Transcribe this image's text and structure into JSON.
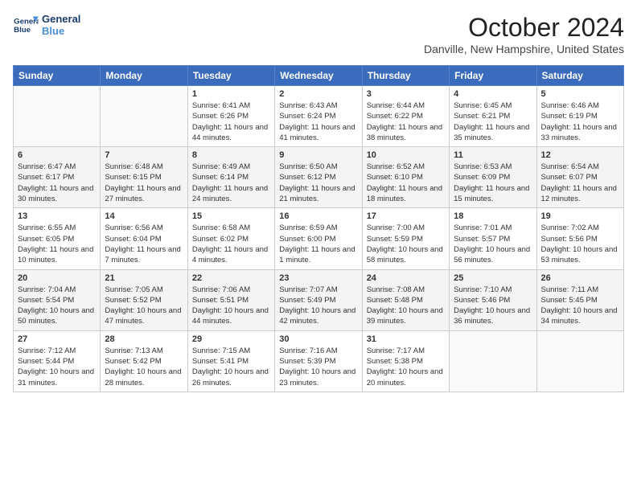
{
  "header": {
    "logo_line1": "General",
    "logo_line2": "Blue",
    "month": "October 2024",
    "location": "Danville, New Hampshire, United States"
  },
  "weekdays": [
    "Sunday",
    "Monday",
    "Tuesday",
    "Wednesday",
    "Thursday",
    "Friday",
    "Saturday"
  ],
  "weeks": [
    [
      {
        "day": "",
        "info": ""
      },
      {
        "day": "",
        "info": ""
      },
      {
        "day": "1",
        "info": "Sunrise: 6:41 AM\nSunset: 6:26 PM\nDaylight: 11 hours and 44 minutes."
      },
      {
        "day": "2",
        "info": "Sunrise: 6:43 AM\nSunset: 6:24 PM\nDaylight: 11 hours and 41 minutes."
      },
      {
        "day": "3",
        "info": "Sunrise: 6:44 AM\nSunset: 6:22 PM\nDaylight: 11 hours and 38 minutes."
      },
      {
        "day": "4",
        "info": "Sunrise: 6:45 AM\nSunset: 6:21 PM\nDaylight: 11 hours and 35 minutes."
      },
      {
        "day": "5",
        "info": "Sunrise: 6:46 AM\nSunset: 6:19 PM\nDaylight: 11 hours and 33 minutes."
      }
    ],
    [
      {
        "day": "6",
        "info": "Sunrise: 6:47 AM\nSunset: 6:17 PM\nDaylight: 11 hours and 30 minutes."
      },
      {
        "day": "7",
        "info": "Sunrise: 6:48 AM\nSunset: 6:15 PM\nDaylight: 11 hours and 27 minutes."
      },
      {
        "day": "8",
        "info": "Sunrise: 6:49 AM\nSunset: 6:14 PM\nDaylight: 11 hours and 24 minutes."
      },
      {
        "day": "9",
        "info": "Sunrise: 6:50 AM\nSunset: 6:12 PM\nDaylight: 11 hours and 21 minutes."
      },
      {
        "day": "10",
        "info": "Sunrise: 6:52 AM\nSunset: 6:10 PM\nDaylight: 11 hours and 18 minutes."
      },
      {
        "day": "11",
        "info": "Sunrise: 6:53 AM\nSunset: 6:09 PM\nDaylight: 11 hours and 15 minutes."
      },
      {
        "day": "12",
        "info": "Sunrise: 6:54 AM\nSunset: 6:07 PM\nDaylight: 11 hours and 12 minutes."
      }
    ],
    [
      {
        "day": "13",
        "info": "Sunrise: 6:55 AM\nSunset: 6:05 PM\nDaylight: 11 hours and 10 minutes."
      },
      {
        "day": "14",
        "info": "Sunrise: 6:56 AM\nSunset: 6:04 PM\nDaylight: 11 hours and 7 minutes."
      },
      {
        "day": "15",
        "info": "Sunrise: 6:58 AM\nSunset: 6:02 PM\nDaylight: 11 hours and 4 minutes."
      },
      {
        "day": "16",
        "info": "Sunrise: 6:59 AM\nSunset: 6:00 PM\nDaylight: 11 hours and 1 minute."
      },
      {
        "day": "17",
        "info": "Sunrise: 7:00 AM\nSunset: 5:59 PM\nDaylight: 10 hours and 58 minutes."
      },
      {
        "day": "18",
        "info": "Sunrise: 7:01 AM\nSunset: 5:57 PM\nDaylight: 10 hours and 56 minutes."
      },
      {
        "day": "19",
        "info": "Sunrise: 7:02 AM\nSunset: 5:56 PM\nDaylight: 10 hours and 53 minutes."
      }
    ],
    [
      {
        "day": "20",
        "info": "Sunrise: 7:04 AM\nSunset: 5:54 PM\nDaylight: 10 hours and 50 minutes."
      },
      {
        "day": "21",
        "info": "Sunrise: 7:05 AM\nSunset: 5:52 PM\nDaylight: 10 hours and 47 minutes."
      },
      {
        "day": "22",
        "info": "Sunrise: 7:06 AM\nSunset: 5:51 PM\nDaylight: 10 hours and 44 minutes."
      },
      {
        "day": "23",
        "info": "Sunrise: 7:07 AM\nSunset: 5:49 PM\nDaylight: 10 hours and 42 minutes."
      },
      {
        "day": "24",
        "info": "Sunrise: 7:08 AM\nSunset: 5:48 PM\nDaylight: 10 hours and 39 minutes."
      },
      {
        "day": "25",
        "info": "Sunrise: 7:10 AM\nSunset: 5:46 PM\nDaylight: 10 hours and 36 minutes."
      },
      {
        "day": "26",
        "info": "Sunrise: 7:11 AM\nSunset: 5:45 PM\nDaylight: 10 hours and 34 minutes."
      }
    ],
    [
      {
        "day": "27",
        "info": "Sunrise: 7:12 AM\nSunset: 5:44 PM\nDaylight: 10 hours and 31 minutes."
      },
      {
        "day": "28",
        "info": "Sunrise: 7:13 AM\nSunset: 5:42 PM\nDaylight: 10 hours and 28 minutes."
      },
      {
        "day": "29",
        "info": "Sunrise: 7:15 AM\nSunset: 5:41 PM\nDaylight: 10 hours and 26 minutes."
      },
      {
        "day": "30",
        "info": "Sunrise: 7:16 AM\nSunset: 5:39 PM\nDaylight: 10 hours and 23 minutes."
      },
      {
        "day": "31",
        "info": "Sunrise: 7:17 AM\nSunset: 5:38 PM\nDaylight: 10 hours and 20 minutes."
      },
      {
        "day": "",
        "info": ""
      },
      {
        "day": "",
        "info": ""
      }
    ]
  ]
}
